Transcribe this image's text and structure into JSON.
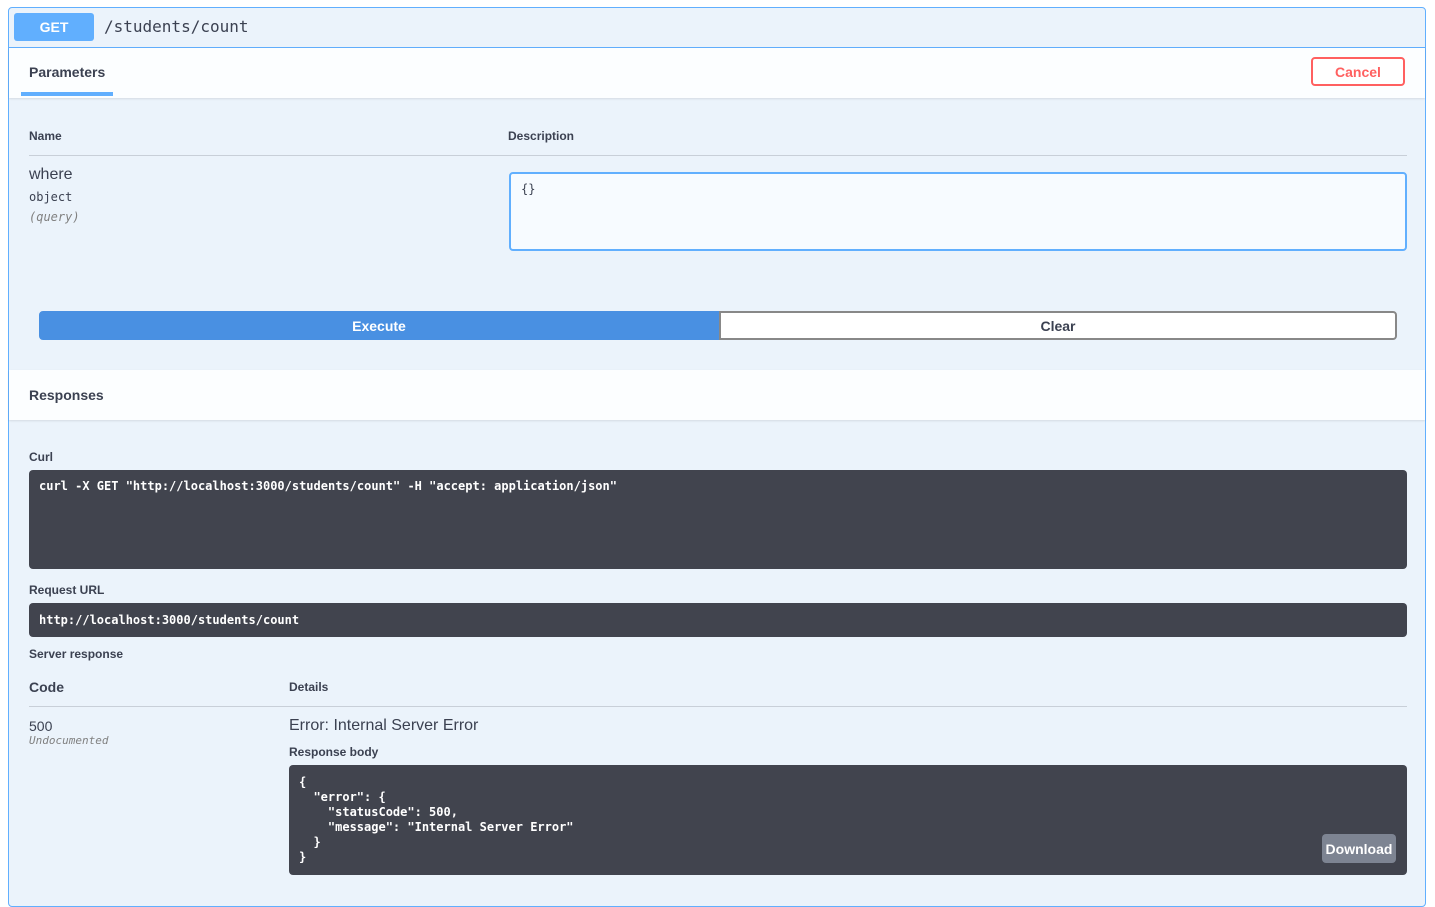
{
  "operation": {
    "method": "GET",
    "path": "/students/count"
  },
  "tabs": {
    "parameters": "Parameters",
    "cancel": "Cancel"
  },
  "params_table": {
    "name_header": "Name",
    "description_header": "Description",
    "param": {
      "name": "where",
      "type": "object",
      "in": "(query)",
      "value": "{}"
    }
  },
  "actions": {
    "execute": "Execute",
    "clear": "Clear"
  },
  "responses": {
    "title": "Responses",
    "curl_label": "Curl",
    "curl": "curl -X GET \"http://localhost:3000/students/count\" -H \"accept: application/json\"",
    "request_url_label": "Request URL",
    "request_url": "http://localhost:3000/students/count",
    "server_response_label": "Server response",
    "code_header": "Code",
    "details_header": "Details",
    "status_code": "500",
    "status_note": "Undocumented",
    "error_title": "Error: Internal Server Error",
    "body_label": "Response body",
    "body": "{\n  \"error\": {\n    \"statusCode\": 500,\n    \"message\": \"Internal Server Error\"\n  }\n}",
    "download": "Download"
  },
  "colors": {
    "get": "#61affe",
    "execute": "#4990e2",
    "cancel": "#ff6060",
    "code_bg": "#41444e"
  }
}
